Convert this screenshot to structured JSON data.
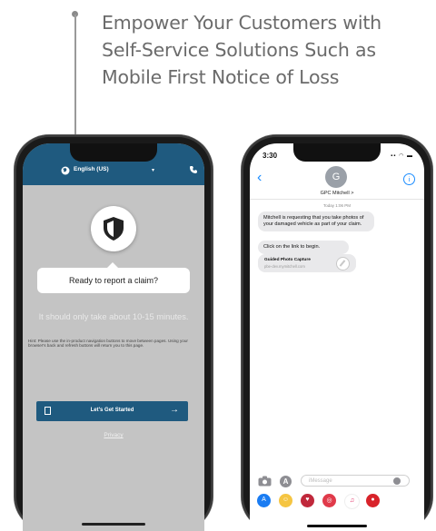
{
  "headline": {
    "lines": [
      "Empower Your Customers with",
      "Self-Service Solutions Such as",
      "Mobile First Notice of Loss"
    ]
  },
  "left_phone": {
    "language": "English (US)",
    "prompt": "Ready to report a claim?",
    "duration": "It should only take about 10-15 minutes.",
    "hint": "Hint: Please use the in-product navigation buttons to move between pages. Using your browser's back and refresh buttons will return you to this page.",
    "cta_label": "Let's Get Started",
    "privacy_label": "Privacy",
    "accent_color": "#1f5a7f"
  },
  "right_phone": {
    "status_time": "3:30",
    "avatar_initial": "G",
    "contact_name": "GPC Mitchell >",
    "message_time": "Today 1:06 PM",
    "messages": [
      "Mitchell is requesting that you take photos of your damaged vehicle as part of your claim.",
      "Click on the link to begin."
    ],
    "link_title": "Guided Photo Capture",
    "link_url": "pbe-dev.mymitchell.com",
    "input_placeholder": "iMessage",
    "tray_apps": [
      "app-store-icon",
      "memoji-icon",
      "heart-sticker-icon",
      "search-app-icon",
      "music-icon",
      "game-icon"
    ]
  }
}
